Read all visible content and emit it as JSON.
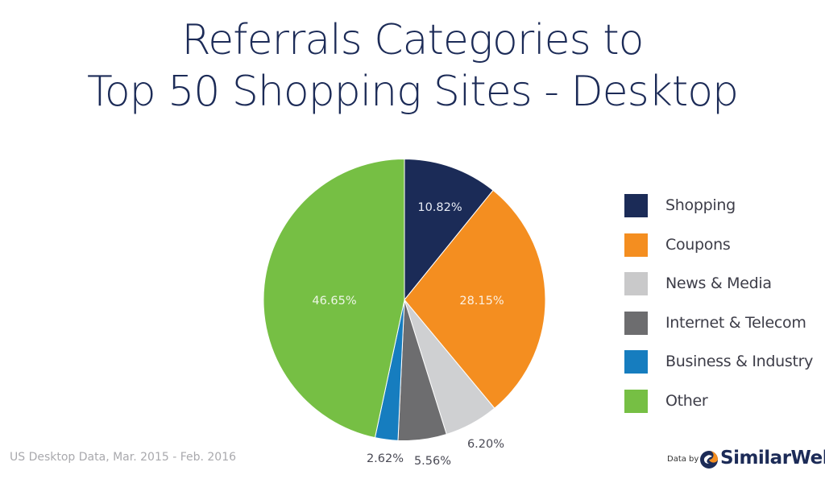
{
  "chart_data": {
    "type": "pie",
    "title": "Referrals Categories to Top 50 Shopping Sites - Desktop",
    "title_lines": [
      "Referrals Categories to",
      "Top 50 Shopping Sites - Desktop"
    ],
    "unit": "%",
    "start_angle_deg": 0,
    "direction": "clockwise",
    "legend_position": "right",
    "slices": [
      {
        "name": "Shopping",
        "value": 10.82,
        "label": "10.82%",
        "color": "#1b2b57",
        "label_inside": true,
        "label_color": "#e8ecf5"
      },
      {
        "name": "Coupons",
        "value": 28.15,
        "label": "28.15%",
        "color": "#f48e20",
        "label_inside": true,
        "label_color": "#fdf1e2"
      },
      {
        "name": "News & Media",
        "value": 6.2,
        "label": "6.20%",
        "color": "#cfd0d2",
        "label_inside": false,
        "label_color": "#4a4a55"
      },
      {
        "name": "Internet & Telecom",
        "value": 5.56,
        "label": "5.56%",
        "color": "#6d6d6f",
        "label_inside": false,
        "label_color": "#4a4a55"
      },
      {
        "name": "Business & Industry",
        "value": 2.62,
        "label": "2.62%",
        "color": "#167dbf",
        "label_inside": false,
        "label_color": "#4a4a55"
      },
      {
        "name": "Other",
        "value": 46.65,
        "label": "46.65%",
        "color": "#76bf44",
        "label_inside": true,
        "label_color": "#eef7e7"
      }
    ]
  },
  "legend": {
    "items": [
      {
        "label": "Shopping",
        "color": "#1b2b57"
      },
      {
        "label": "Coupons",
        "color": "#f48e20"
      },
      {
        "label": "News & Media",
        "color": "#c9c9ca"
      },
      {
        "label": "Internet & Telecom",
        "color": "#6d6d6f"
      },
      {
        "label": "Business & Industry",
        "color": "#167dbf"
      },
      {
        "label": "Other",
        "color": "#76bf44"
      }
    ]
  },
  "footer": {
    "note": "US Desktop Data, Mar. 2015 - Feb. 2016",
    "credit_prefix": "Data by",
    "brand": "SimilarWeb",
    "brand_icon": "similarweb-logo-icon"
  }
}
